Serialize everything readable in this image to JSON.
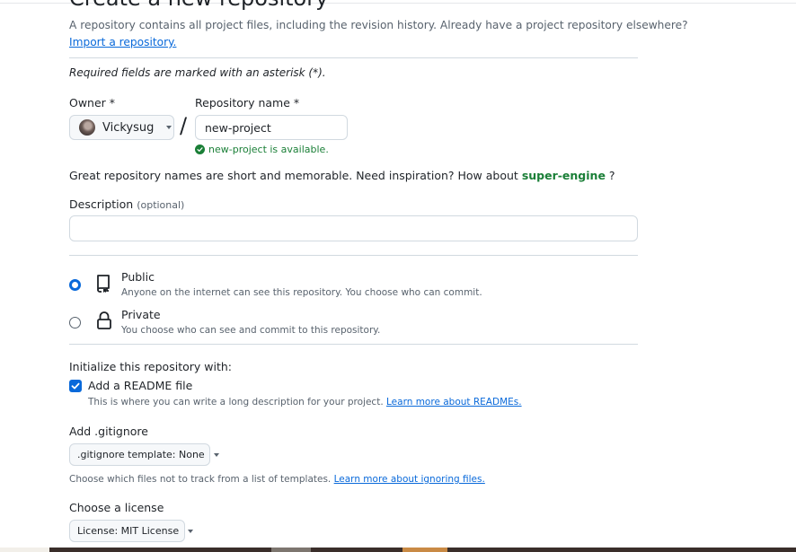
{
  "page": {
    "title": "Create a new repository",
    "intro": "A repository contains all project files, including the revision history. Already have a project repository elsewhere?",
    "import_link": "Import a repository.",
    "required_note": "Required fields are marked with an asterisk (*)."
  },
  "owner": {
    "label": "Owner *",
    "selected": "Vickysug",
    "avatar_icon": "user-avatar"
  },
  "repo": {
    "separator": "/",
    "label": "Repository name *",
    "value": "new-project",
    "availability": "new-project is available."
  },
  "suggestion": {
    "prefix": "Great repository names are short and memorable. Need inspiration? How about",
    "name": "super-engine",
    "suffix": "?"
  },
  "description": {
    "label": "Description",
    "optional": "(optional)",
    "value": ""
  },
  "visibility": {
    "public": {
      "title": "Public",
      "subtitle": "Anyone on the internet can see this repository. You choose who can commit.",
      "icon": "repo-icon",
      "selected": true
    },
    "private": {
      "title": "Private",
      "subtitle": "You choose who can see and commit to this repository.",
      "icon": "lock-icon",
      "selected": false
    }
  },
  "initialize": {
    "heading": "Initialize this repository with:",
    "readme_label": "Add a README file",
    "readme_checked": true,
    "readme_help": "This is where you can write a long description for your project.",
    "readme_link": "Learn more about READMEs."
  },
  "gitignore": {
    "heading": "Add .gitignore",
    "select": ".gitignore template: None",
    "help": "Choose which files not to track from a list of templates.",
    "link": "Learn more about ignoring files."
  },
  "license": {
    "heading": "Choose a license",
    "select": "License: MIT License"
  },
  "colors": {
    "accent": "#0969da",
    "success": "#1a7f37",
    "muted": "#59636e",
    "border": "#d1d9e0"
  }
}
